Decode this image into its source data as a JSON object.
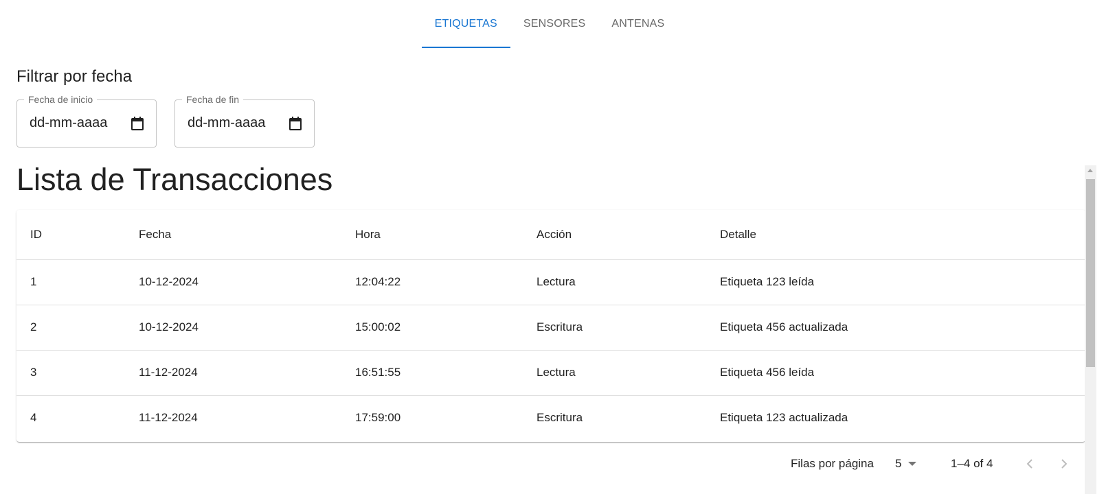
{
  "tabs": [
    {
      "label": "ETIQUETAS",
      "active": true
    },
    {
      "label": "SENSORES",
      "active": false
    },
    {
      "label": "ANTENAS",
      "active": false
    }
  ],
  "accent_color": "#1976d2",
  "filter": {
    "title": "Filtrar por fecha",
    "start": {
      "label": "Fecha de inicio",
      "value": "dd-mm-aaaa",
      "icon": "calendar-icon"
    },
    "end": {
      "label": "Fecha de fin",
      "value": "dd-mm-aaaa",
      "icon": "calendar-icon"
    }
  },
  "list_title": "Lista de Transacciones",
  "table": {
    "headers": [
      "ID",
      "Fecha",
      "Hora",
      "Acción",
      "Detalle"
    ],
    "rows": [
      [
        "1",
        "10-12-2024",
        "12:04:22",
        "Lectura",
        "Etiqueta 123 leída"
      ],
      [
        "2",
        "10-12-2024",
        "15:00:02",
        "Escritura",
        "Etiqueta 456 actualizada"
      ],
      [
        "3",
        "11-12-2024",
        "16:51:55",
        "Lectura",
        "Etiqueta 456 leída"
      ],
      [
        "4",
        "11-12-2024",
        "17:59:00",
        "Escritura",
        "Etiqueta 123 actualizada"
      ]
    ]
  },
  "pagination": {
    "rows_per_page_label": "Filas por página",
    "rows_per_page_value": "5",
    "range": "1–4 of 4",
    "prev_icon": "chevron-left-icon",
    "next_icon": "chevron-right-icon"
  }
}
